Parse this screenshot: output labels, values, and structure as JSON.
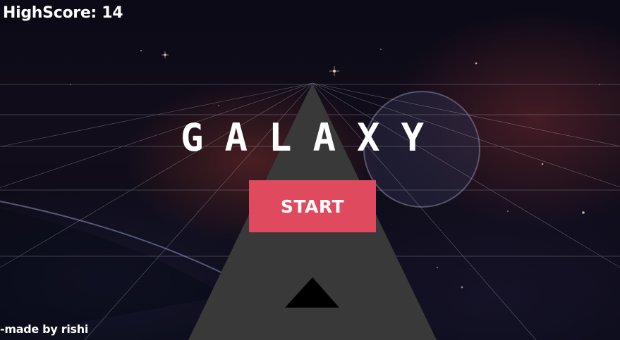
{
  "hud": {
    "highscore_label": "HighScore: 14",
    "credit": "-made by rishi"
  },
  "menu": {
    "title": "GALAXY",
    "start_label": "START"
  },
  "colors": {
    "start_button": "#e04a5f",
    "road": "#3a3a3a",
    "ship": "#000000",
    "text": "#ffffff"
  },
  "icons": {
    "ship": "triangle-ship-icon",
    "planet": "planet-icon"
  }
}
